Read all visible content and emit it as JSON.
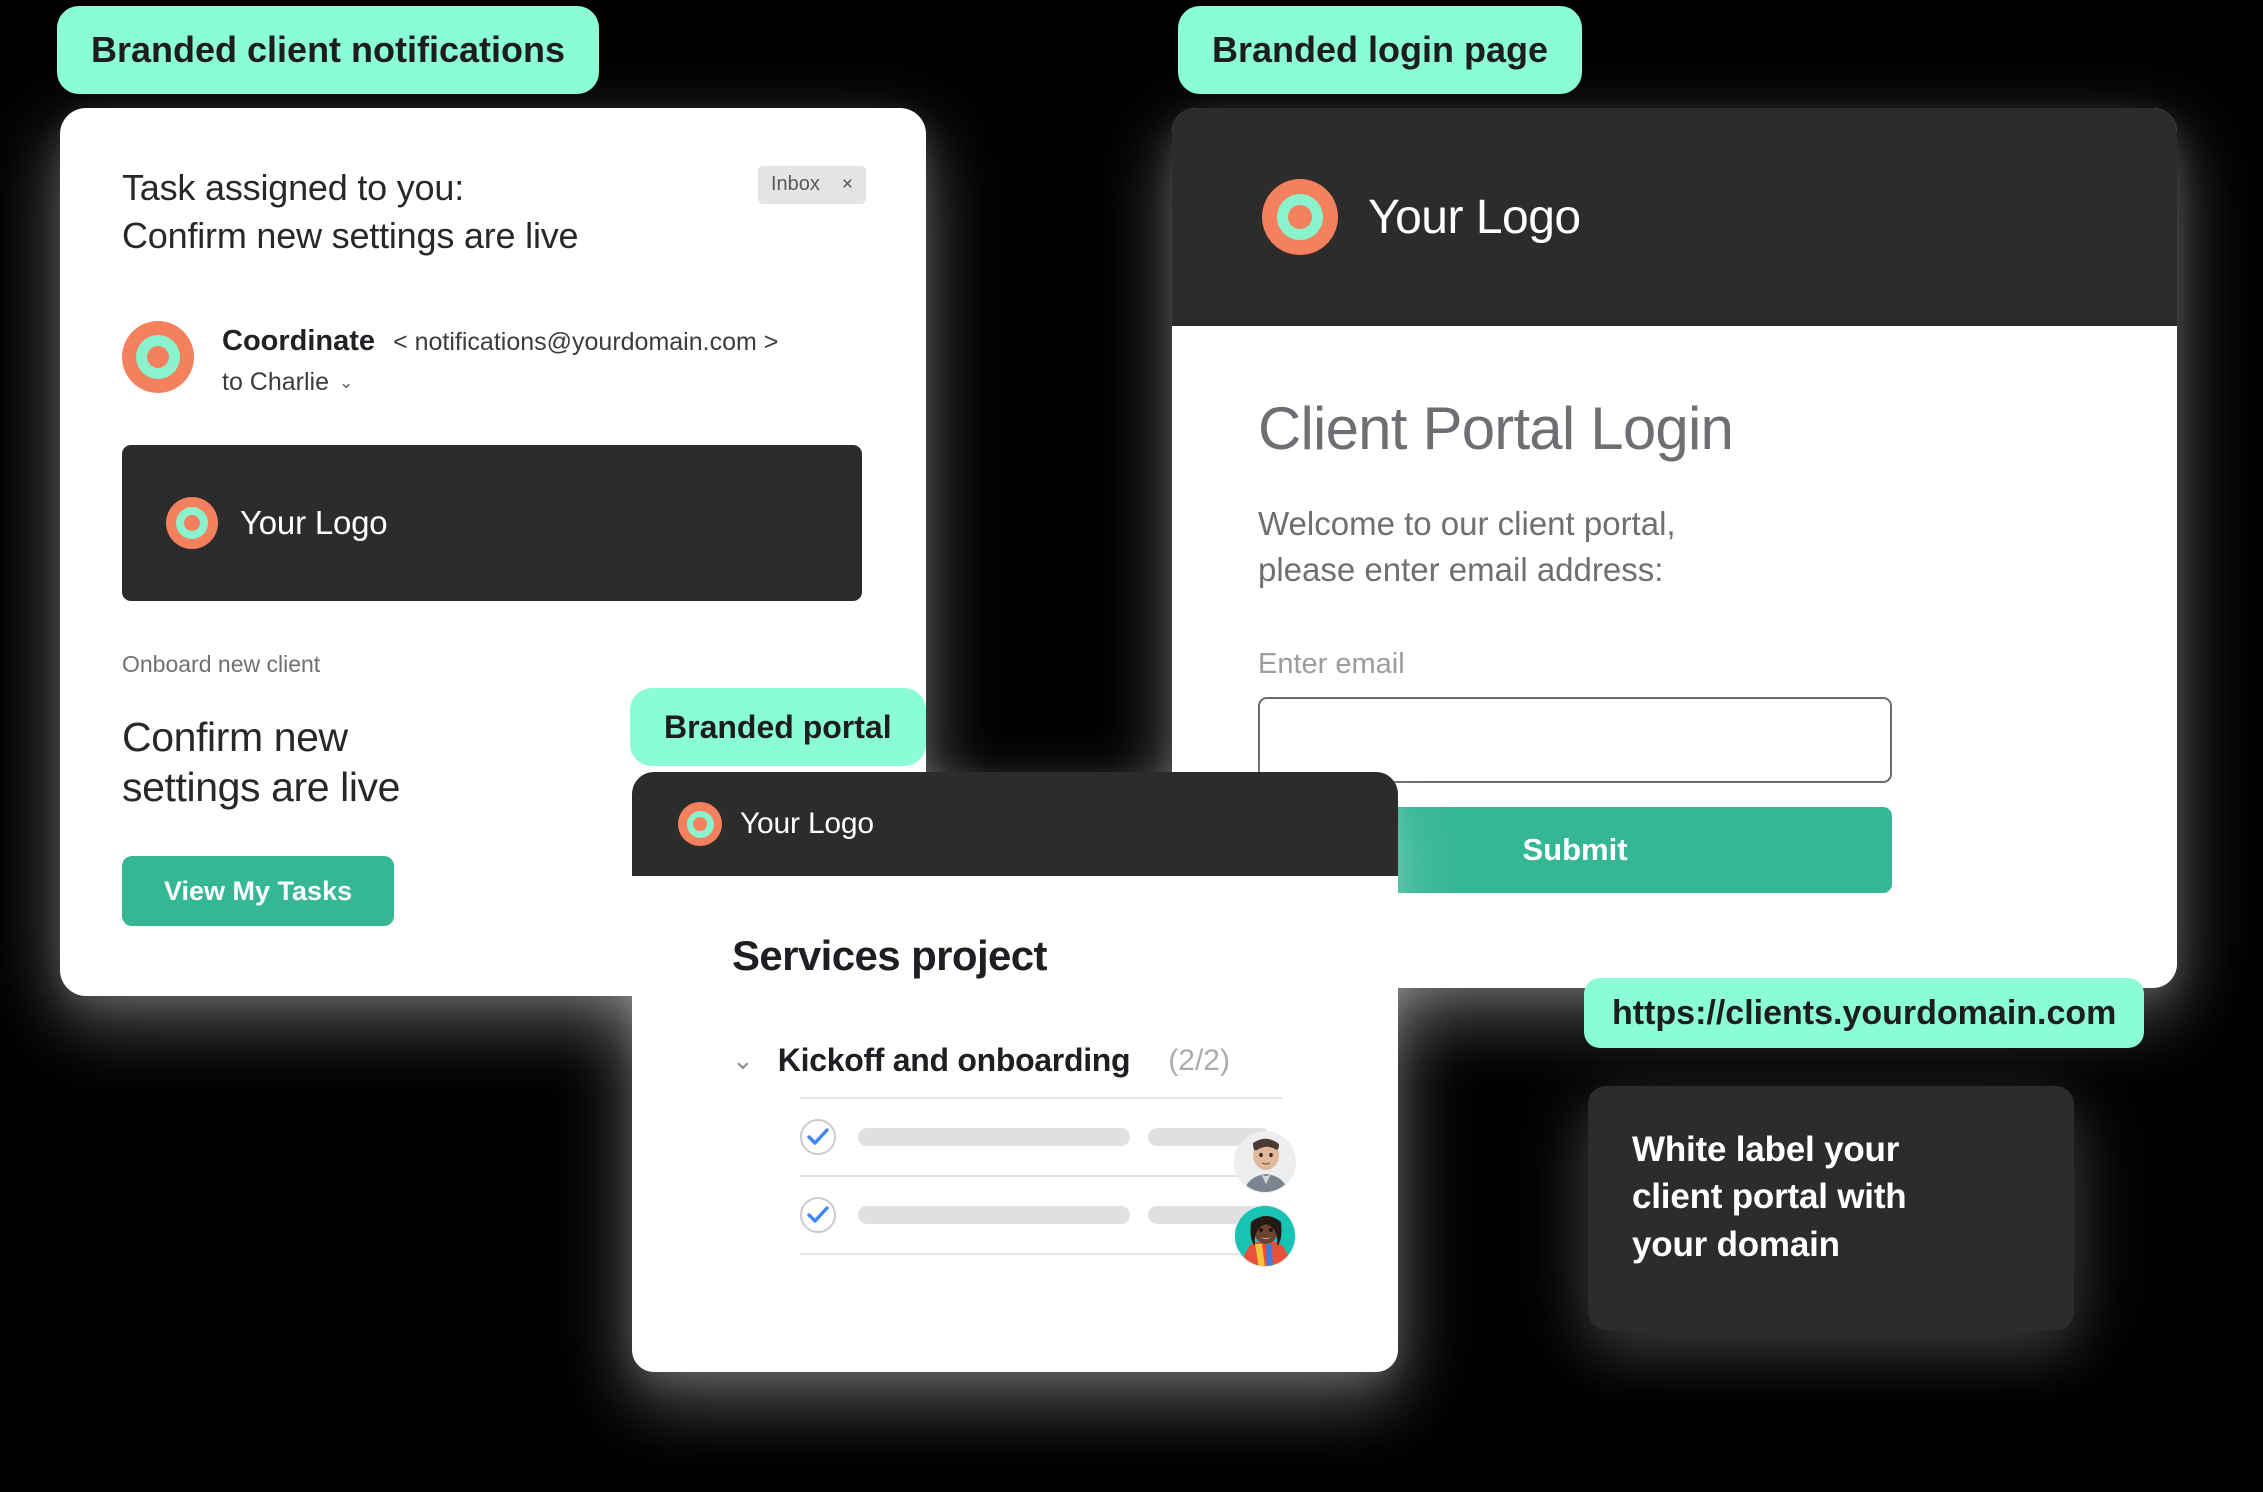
{
  "tabs": {
    "notifications": "Branded client notifications",
    "login": "Branded login page",
    "portal": "Branded portal"
  },
  "email": {
    "subject_line1": "Task assigned to you:",
    "subject_line2": "Confirm new settings are live",
    "inbox_chip": "Inbox",
    "inbox_close": "×",
    "sender_name": "Coordinate",
    "sender_email": "< notifications@yourdomain.com >",
    "recipient": "to Charlie",
    "recipient_chevron": "⌄",
    "brand_text": "Your Logo",
    "eyebrow": "Onboard new client",
    "body_line1": "Confirm new",
    "body_line2": "settings are live",
    "cta_label": "View My Tasks"
  },
  "login": {
    "brand_text": "Your Logo",
    "title": "Client Portal Login",
    "subtitle_line1": "Welcome to our client portal,",
    "subtitle_line2": "please enter email address:",
    "field_label": "Enter email",
    "field_value": "",
    "field_placeholder": "",
    "submit_label": "Submit"
  },
  "portal": {
    "brand_text": "Your Logo",
    "project_title": "Services project",
    "section_chevron": "⌄",
    "section_name": "Kickoff and onboarding",
    "section_count": "(2/2)",
    "tasks": [
      {
        "checked": true,
        "assignee": "avatar-male"
      },
      {
        "checked": true,
        "assignee": "avatar-female"
      }
    ]
  },
  "callouts": {
    "url": "https://clients.yourdomain.com",
    "white_label_line1": "White label your",
    "white_label_line2": "client portal with",
    "white_label_line3": "your domain"
  },
  "colors": {
    "mint": "#8AFCD8",
    "orange": "#F4805E",
    "logo_inner_mint": "#8AF3CE",
    "dark": "#2C2C2C",
    "green_button": "#35B795",
    "check_blue": "#4285F4"
  }
}
